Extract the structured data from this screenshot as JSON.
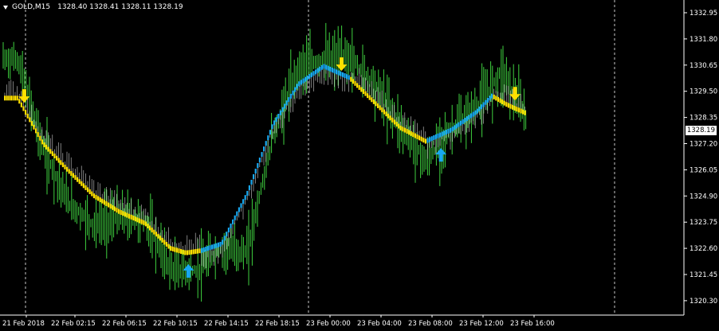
{
  "chart_header": {
    "symbol": "GOLD,M15",
    "ohlc": "1328.40 1328.41 1328.11 1328.19"
  },
  "current_price_label": "1328.19",
  "colors": {
    "background": "#000000",
    "candle": "#3fd13f",
    "indicator_down": "#ffe000",
    "indicator_up": "#18a8f0",
    "grid": "#c8c8c8",
    "axis": "#ffffff"
  },
  "icons": {
    "sell_signal": "yellow-down-arrow-icon",
    "buy_signal": "blue-up-arrow-icon"
  },
  "chart_data": {
    "type": "line",
    "title": "GOLD,M15",
    "xlabel": "",
    "ylabel": "",
    "ylim": [
      1320.0,
      1333.5
    ],
    "y_ticks": [
      "1332.95",
      "1331.80",
      "1330.65",
      "1329.50",
      "1328.35",
      "1327.20",
      "1326.05",
      "1324.90",
      "1323.75",
      "1322.60",
      "1321.45",
      "1320.30"
    ],
    "x_ticks": [
      "21 Feb 2018",
      "22 Feb 02:15",
      "22 Feb 06:15",
      "22 Feb 10:15",
      "22 Feb 14:15",
      "22 Feb 18:15",
      "23 Feb 00:00",
      "23 Feb 04:00",
      "23 Feb 08:00",
      "23 Feb 12:00",
      "23 Feb 16:00"
    ],
    "grid": "vertical dashed lines at day separators",
    "series": [
      {
        "kind": "price",
        "x": [
          0,
          0.5,
          1,
          1.5,
          2,
          2.5,
          3,
          3.5,
          4,
          4.5,
          5,
          5.5,
          6,
          6.5,
          7,
          7.5,
          8,
          8.5,
          9,
          9.5,
          10
        ],
        "values": [
          1330.9,
          1327.0,
          1324.6,
          1323.6,
          1324.0,
          1323.8,
          1321.7,
          1321.6,
          1322.6,
          1322.4,
          1327.5,
          1330.5,
          1330.9,
          1331.0,
          1329.8,
          1328.0,
          1326.4,
          1327.8,
          1328.8,
          1330.4,
          1328.2
        ]
      },
      {
        "kind": "indicator",
        "x": [
          0,
          0.5,
          1,
          1.5,
          2,
          2.5,
          3,
          3.3,
          3.6,
          4,
          4.5,
          5,
          5.5,
          6,
          6.5,
          7,
          7.5,
          8,
          8.5,
          9,
          9.3,
          9.6,
          10
        ],
        "values": [
          1329.2,
          1327.2,
          1326.0,
          1324.9,
          1324.2,
          1323.7,
          1322.6,
          1322.4,
          1322.5,
          1322.8,
          1325.0,
          1328.0,
          1329.8,
          1330.6,
          1330.1,
          1329.0,
          1327.9,
          1327.3,
          1327.8,
          1328.6,
          1329.3,
          1328.9,
          1328.5
        ],
        "direction": [
          "down",
          "down",
          "down",
          "down",
          "down",
          "down",
          "down",
          "down",
          "up",
          "up",
          "up",
          "up",
          "up",
          "up",
          "down",
          "down",
          "down",
          "up",
          "up",
          "up",
          "down",
          "down",
          "down"
        ]
      }
    ],
    "signals": [
      {
        "type": "sell",
        "x": 0.13,
        "y": 1329.1
      },
      {
        "type": "buy",
        "x": 3.35,
        "y": 1321.8
      },
      {
        "type": "sell",
        "x": 6.35,
        "y": 1330.5
      },
      {
        "type": "buy",
        "x": 8.3,
        "y": 1326.9
      },
      {
        "type": "sell",
        "x": 9.75,
        "y": 1329.2
      }
    ]
  }
}
